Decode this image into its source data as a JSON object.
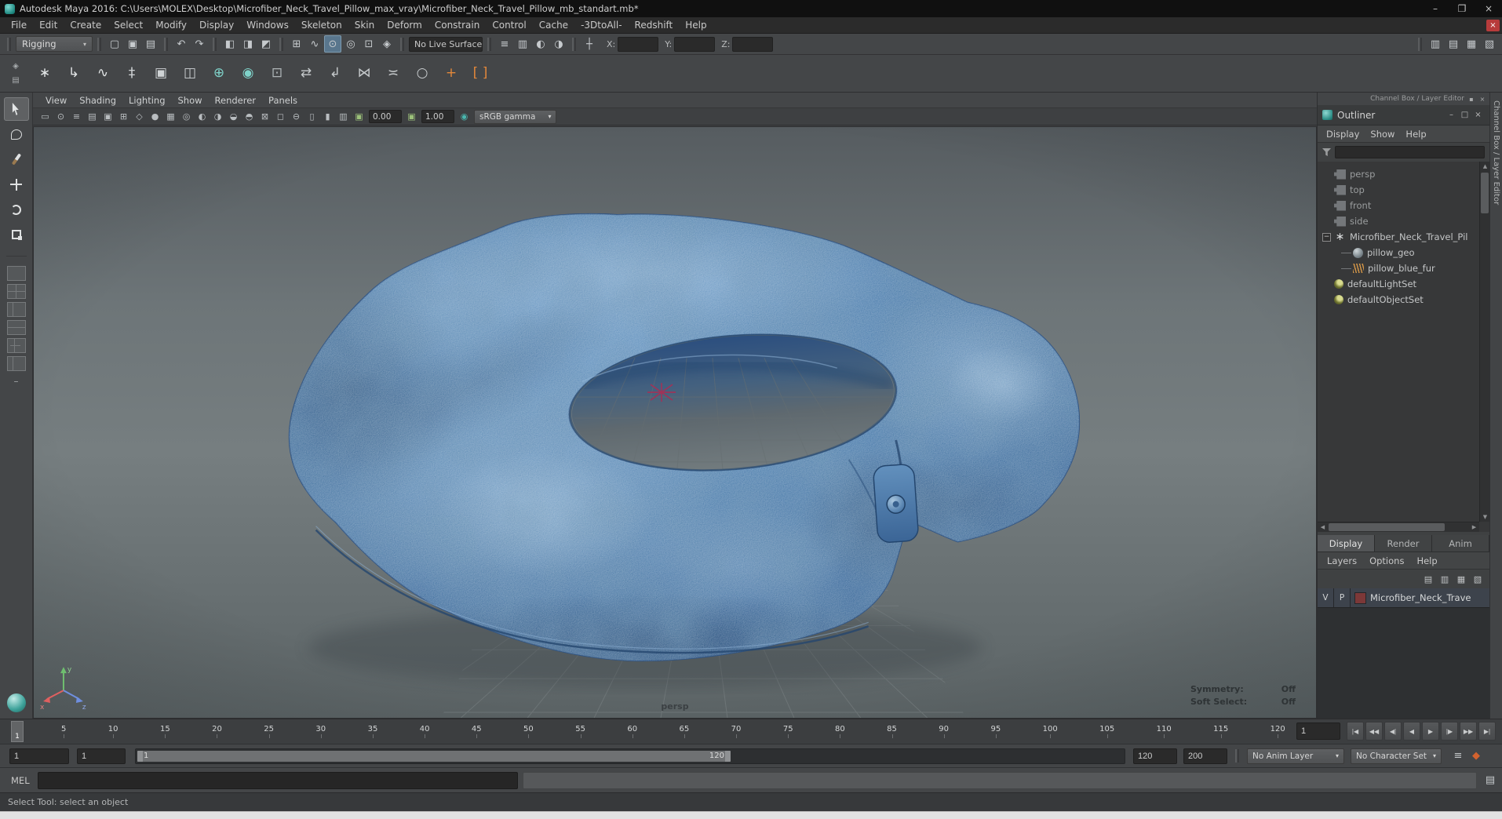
{
  "window": {
    "title": "Autodesk Maya 2016: C:\\Users\\MOLEX\\Desktop\\Microfiber_Neck_Travel_Pillow_max_vray\\Microfiber_Neck_Travel_Pillow_mb_standart.mb*",
    "minimize": "–",
    "maximize": "❐",
    "close": "×"
  },
  "menubar": {
    "items": [
      "File",
      "Edit",
      "Create",
      "Select",
      "Modify",
      "Display",
      "Windows",
      "Skeleton",
      "Skin",
      "Deform",
      "Constrain",
      "Control",
      "Cache",
      "-3DtoAll-",
      "Redshift",
      "Help"
    ],
    "close_glyph": "×"
  },
  "statusline": {
    "menu_set_label": "Rigging",
    "live_surface_label": "No Live Surface",
    "file_icons": [
      {
        "name": "new-scene-icon",
        "g": "▢"
      },
      {
        "name": "open-scene-icon",
        "g": "▣"
      },
      {
        "name": "save-scene-icon",
        "g": "▤"
      }
    ],
    "history_icons": [
      {
        "name": "undo-icon",
        "g": "↶"
      },
      {
        "name": "redo-icon",
        "g": "↷"
      }
    ],
    "selection_icons": [
      {
        "name": "select-hierarchy-icon",
        "g": "◧"
      },
      {
        "name": "select-object-icon",
        "g": "◨"
      },
      {
        "name": "select-component-icon",
        "g": "◩"
      }
    ],
    "snap_icons": [
      {
        "name": "snap-to-grid-icon",
        "g": "⊞"
      },
      {
        "name": "snap-to-curve-icon",
        "g": "∿"
      },
      {
        "name": "snap-to-point-icon",
        "g": "⊙",
        "cls": "active"
      },
      {
        "name": "snap-to-projected-center-icon",
        "g": "◎"
      },
      {
        "name": "snap-to-view-plane-icon",
        "g": "⊡"
      },
      {
        "name": "make-live-icon",
        "g": "◈"
      }
    ],
    "render_icons": [
      {
        "name": "construction-history-icon",
        "g": "≡"
      },
      {
        "name": "open-render-view-icon",
        "g": "▥"
      },
      {
        "name": "render-current-frame-icon",
        "g": "◐"
      },
      {
        "name": "render-settings-icon",
        "g": "◑"
      }
    ],
    "entry_icons": [
      {
        "name": "transform-entry-icon",
        "g": "┼"
      }
    ],
    "coords": [
      {
        "label": "X:"
      },
      {
        "label": "Y:"
      },
      {
        "label": "Z:"
      }
    ],
    "panel_toggle_icons": [
      {
        "name": "toggle-modeling-toolkit-icon",
        "g": "▥"
      },
      {
        "name": "toggle-attribute-editor-icon",
        "g": "▤"
      },
      {
        "name": "toggle-tool-settings-icon",
        "g": "▦"
      },
      {
        "name": "toggle-channel-box-icon",
        "g": "▧"
      }
    ]
  },
  "shelf": {
    "left_icons": [
      {
        "name": "shelf-options-icon",
        "g": "◈"
      },
      {
        "name": "shelf-tabs-icon",
        "g": "▤"
      }
    ],
    "icons": [
      {
        "name": "joint-tool-icon",
        "g": "∗",
        "c": "#e2e5e6"
      },
      {
        "name": "ik-handle-icon",
        "g": "↳",
        "c": "#e2e5e6"
      },
      {
        "name": "ik-spline-handle-icon",
        "g": "∿",
        "c": "#e2e5e6"
      },
      {
        "name": "constraint-icon",
        "g": "‡",
        "c": "#cfd3d5"
      },
      {
        "name": "humanik-icon",
        "g": "▣",
        "c": "#cfd3d5"
      },
      {
        "name": "character-controls-icon",
        "g": "◫",
        "c": "#cfd3d5"
      },
      {
        "name": "quick-rig-icon",
        "g": "⊕",
        "c": "#7fd2c9"
      },
      {
        "name": "hik-skeleton-icon",
        "g": "◉",
        "c": "#7fd2c9"
      },
      {
        "name": "control-rig-icon",
        "g": "⊡",
        "c": "#aeb4b6"
      },
      {
        "name": "ik-fk-blend-icon",
        "g": "⇄",
        "c": "#c6cacc"
      },
      {
        "name": "curve-warp-icon",
        "g": "↲",
        "c": "#c6cacc"
      },
      {
        "name": "chain-constraint-icon",
        "g": "⋈",
        "c": "#c6cacc"
      },
      {
        "name": "pose-editor-icon",
        "g": "≍",
        "c": "#c6cacc"
      },
      {
        "name": "skin-weights-icon",
        "g": "○",
        "c": "#c6cacc"
      },
      {
        "name": "add-keyframe-icon",
        "g": "+",
        "c": "#e2883a"
      },
      {
        "name": "set-range-icon",
        "g": "[ ]",
        "c": "#e2883a"
      }
    ]
  },
  "toolbox": {
    "tools": [
      {
        "name": "select-tool",
        "cls": "t-select active"
      },
      {
        "name": "lasso-select-tool",
        "cls": "t-lasso"
      },
      {
        "name": "paint-select-tool",
        "cls": "t-paint"
      },
      {
        "name": "move-tool",
        "cls": "t-move"
      },
      {
        "name": "rotate-tool",
        "cls": "t-rotate"
      },
      {
        "name": "scale-tool",
        "cls": "t-scale"
      }
    ],
    "layouts": [
      {
        "name": "layout-single-pane",
        "cls": "l1"
      },
      {
        "name": "layout-four-pane",
        "cls": "l2"
      },
      {
        "name": "layout-two-pane-side",
        "cls": "l3"
      },
      {
        "name": "layout-two-pane-stacked",
        "cls": "l4"
      },
      {
        "name": "layout-three-pane",
        "cls": "l5"
      },
      {
        "name": "layout-outliner-persp",
        "cls": "l6"
      }
    ]
  },
  "viewport": {
    "menus": [
      "View",
      "Shading",
      "Lighting",
      "Show",
      "Renderer",
      "Panels"
    ],
    "iconbar_icons": [
      {
        "name": "select-camera-icon",
        "g": "▭"
      },
      {
        "name": "lock-camera-icon",
        "g": "⊙"
      },
      {
        "name": "camera-attributes-icon",
        "g": "≡"
      },
      {
        "name": "bookmarks-icon",
        "g": "▤"
      },
      {
        "name": "image-plane-icon",
        "g": "▣"
      },
      {
        "name": "two-d-pan-zoom-icon",
        "g": "⊞"
      },
      {
        "name": "wireframe-icon",
        "g": "◇"
      },
      {
        "name": "smooth-shade-icon",
        "g": "●"
      },
      {
        "name": "textured-icon",
        "g": "▦"
      },
      {
        "name": "use-default-material-icon",
        "g": "◎"
      },
      {
        "name": "lighting-icon",
        "g": "◐"
      },
      {
        "name": "shadows-icon",
        "g": "◑"
      },
      {
        "name": "screen-space-ao-icon",
        "g": "◒"
      },
      {
        "name": "motion-blur-icon",
        "g": "◓"
      },
      {
        "name": "anti-aliasing-icon",
        "g": "⊠"
      },
      {
        "name": "xray-icon",
        "g": "◻"
      },
      {
        "name": "isolate-select-icon",
        "g": "⊖"
      },
      {
        "name": "film-gate-icon",
        "g": "▯"
      },
      {
        "name": "resolution-gate-icon",
        "g": "▮"
      },
      {
        "name": "gate-mask-icon",
        "g": "▥"
      }
    ],
    "exposure_icon": {
      "name": "exposure-icon",
      "g": "▣"
    },
    "gamma_icon": {
      "name": "gamma-icon",
      "g": "▣"
    },
    "exposure_value": "0.00",
    "gamma_value": "1.00",
    "color_mgmt_icon": {
      "name": "color-management-icon",
      "g": "◉"
    },
    "color_transform": "sRGB gamma",
    "camera_label": "persp",
    "overlays": [
      {
        "label": "Symmetry:",
        "value": "Off"
      },
      {
        "label": "Soft Select:",
        "value": "Off"
      }
    ]
  },
  "dock": {
    "header_label": "Channel Box / Layer Editor"
  },
  "right_tab": {
    "label": "Channel Box / Layer Editor"
  },
  "outliner": {
    "title": "Outliner",
    "minimize": "–",
    "maximize": "□",
    "close": "×",
    "menus": [
      "Display",
      "Show",
      "Help"
    ],
    "items": [
      {
        "label": "persp",
        "icon": "camera",
        "cls": "dim"
      },
      {
        "label": "top",
        "icon": "camera",
        "cls": "dim"
      },
      {
        "label": "front",
        "icon": "camera",
        "cls": "dim"
      },
      {
        "label": "side",
        "icon": "camera",
        "cls": "dim"
      },
      {
        "label": "Microfiber_Neck_Travel_Pil",
        "icon": "transform",
        "cls": "root",
        "exp": "−"
      },
      {
        "label": "pillow_geo",
        "icon": "mesh",
        "cls": "child"
      },
      {
        "label": "pillow_blue_fur",
        "icon": "fur",
        "cls": "child"
      },
      {
        "label": "defaultLightSet",
        "icon": "set",
        "cls": ""
      },
      {
        "label": "defaultObjectSet",
        "icon": "set",
        "cls": ""
      }
    ]
  },
  "layer_editor": {
    "tabs": [
      {
        "label": "Display",
        "cls": "active"
      },
      {
        "label": "Render",
        "cls": ""
      },
      {
        "label": "Anim",
        "cls": ""
      }
    ],
    "menus": [
      "Layers",
      "Options",
      "Help"
    ],
    "toolbar_icons": [
      {
        "name": "move-layer-up-icon",
        "g": "▤"
      },
      {
        "name": "new-empty-layer-icon",
        "g": "▥"
      },
      {
        "name": "new-layer-from-selected-icon",
        "g": "▦"
      },
      {
        "name": "delete-layer-icon",
        "g": "▧"
      }
    ],
    "layers": [
      {
        "visible": "V",
        "playback": "P",
        "color": "#7c3838",
        "name": "Microfiber_Neck_Trave"
      }
    ]
  },
  "timeline": {
    "ticks": [
      "5",
      "10",
      "15",
      "20",
      "25",
      "30",
      "35",
      "40",
      "45",
      "50",
      "55",
      "60",
      "65",
      "70",
      "75",
      "80",
      "85",
      "90",
      "95",
      "100",
      "105",
      "110",
      "115",
      "120"
    ],
    "marker_label": "1",
    "current_frame": "1",
    "transport": [
      {
        "name": "go-to-start-button",
        "g": "|◀"
      },
      {
        "name": "step-back-frame-button",
        "g": "◀◀"
      },
      {
        "name": "step-back-key-button",
        "g": "◀|"
      },
      {
        "name": "play-backwards-button",
        "g": "◀"
      },
      {
        "name": "play-forwards-button",
        "g": "▶"
      },
      {
        "name": "step-forward-key-button",
        "g": "|▶"
      },
      {
        "name": "step-forward-frame-button",
        "g": "▶▶"
      },
      {
        "name": "go-to-end-button",
        "g": "▶|"
      }
    ]
  },
  "range_slider": {
    "anim_start": "1",
    "playback_start": "1",
    "range_start_label": "1",
    "range_end_label": "120",
    "playback_end": "120",
    "anim_end": "200",
    "anim_layer": "No Anim Layer",
    "character_set": "No Character Set",
    "icons": [
      {
        "name": "animation-preferences-icon",
        "g": "≡",
        "c": "#c3c6c8"
      },
      {
        "name": "auto-keyframe-icon",
        "g": "◆",
        "c": "#d2622e"
      }
    ]
  },
  "command_line": {
    "label": "MEL",
    "icons": [
      {
        "name": "script-editor-icon",
        "g": "▤"
      }
    ]
  },
  "help_line": {
    "text": "Select Tool: select an object"
  }
}
